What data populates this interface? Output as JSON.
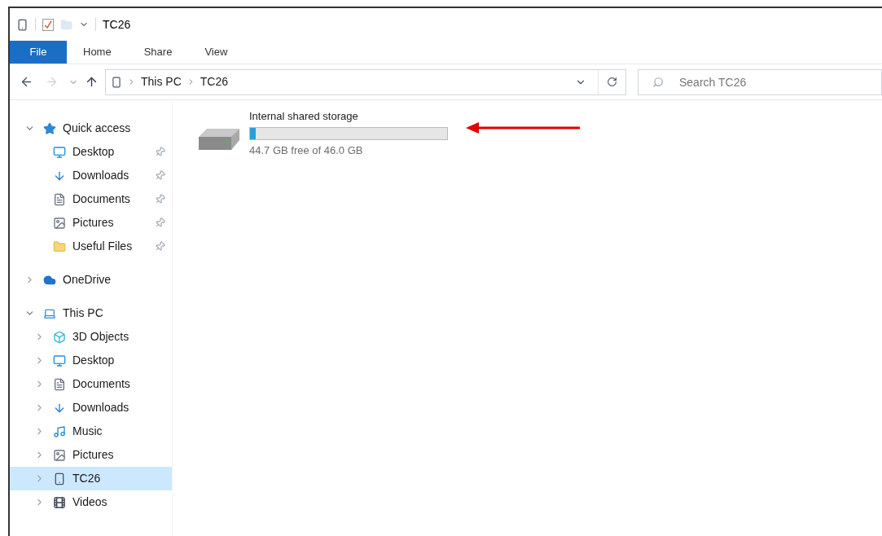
{
  "window": {
    "title": "TC26"
  },
  "ribbon_tabs": [
    {
      "label": "File",
      "selected": true
    },
    {
      "label": "Home",
      "selected": false
    },
    {
      "label": "Share",
      "selected": false
    },
    {
      "label": "View",
      "selected": false
    }
  ],
  "breadcrumb": [
    "This PC",
    "TC26"
  ],
  "search": {
    "placeholder": "Search TC26"
  },
  "navigation": [
    {
      "label": "Quick access",
      "kind": "star",
      "expanded": true,
      "children": [
        {
          "label": "Desktop",
          "kind": "desktop",
          "pinned": true
        },
        {
          "label": "Downloads",
          "kind": "download",
          "pinned": true
        },
        {
          "label": "Documents",
          "kind": "document",
          "pinned": true
        },
        {
          "label": "Pictures",
          "kind": "picture",
          "pinned": true
        },
        {
          "label": "Useful Files",
          "kind": "folder",
          "pinned": true
        }
      ]
    },
    {
      "label": "OneDrive",
      "kind": "cloud",
      "expanded": false
    },
    {
      "label": "This PC",
      "kind": "pc",
      "expanded": true,
      "children": [
        {
          "label": "3D Objects",
          "kind": "cube",
          "selected": false
        },
        {
          "label": "Desktop",
          "kind": "desktop",
          "selected": false
        },
        {
          "label": "Documents",
          "kind": "document",
          "selected": false
        },
        {
          "label": "Downloads",
          "kind": "download",
          "selected": false
        },
        {
          "label": "Music",
          "kind": "music",
          "selected": false
        },
        {
          "label": "Pictures",
          "kind": "picture",
          "selected": false
        },
        {
          "label": "TC26",
          "kind": "device",
          "selected": true
        },
        {
          "label": "Videos",
          "kind": "video",
          "selected": false
        }
      ]
    }
  ],
  "drive": {
    "name": "Internal shared storage",
    "level": 0.03,
    "free_text": "44.7 GB free of 46.0 GB"
  }
}
